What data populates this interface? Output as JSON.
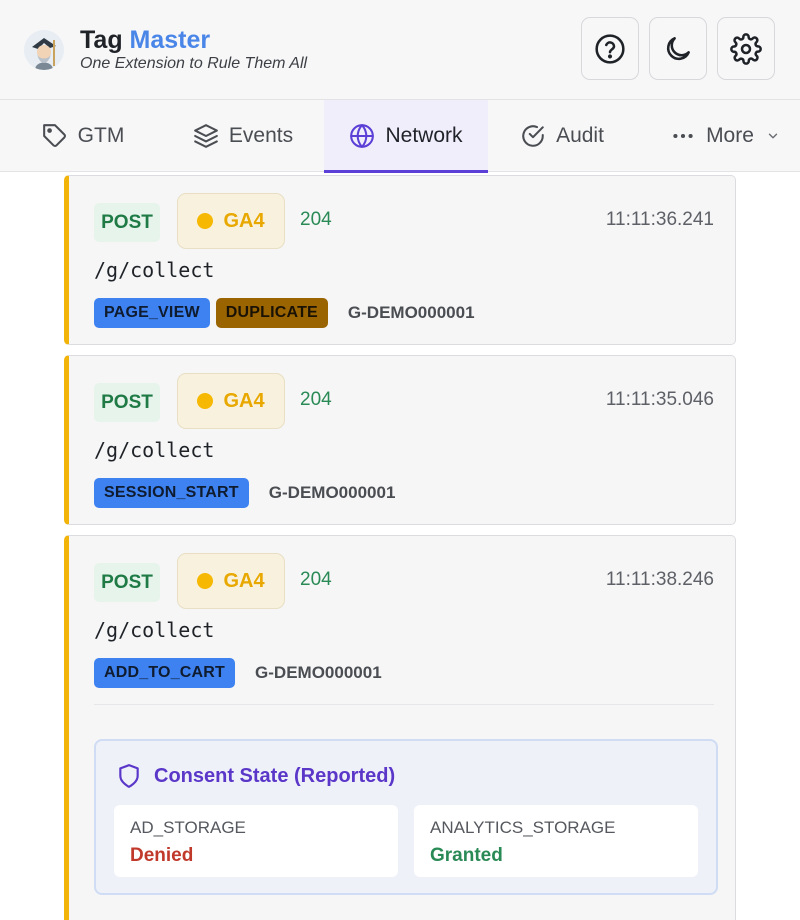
{
  "app": {
    "title_primary": "Tag",
    "title_accent": "Master",
    "subtitle": "One Extension to Rule Them All",
    "buttons": [
      {
        "icon": "help-circle-icon"
      },
      {
        "icon": "moon-icon"
      },
      {
        "icon": "gear-icon"
      }
    ]
  },
  "tabs": [
    {
      "label": "GTM",
      "icon": "tag-icon",
      "active": false
    },
    {
      "label": "Events",
      "icon": "layers-icon",
      "active": false
    },
    {
      "label": "Network",
      "icon": "globe-icon",
      "active": true
    },
    {
      "label": "Audit",
      "icon": "check-circle-icon",
      "active": false
    },
    {
      "label": "More",
      "icon": "ellipsis-icon",
      "active": false
    }
  ],
  "requests": [
    {
      "method": "POST",
      "vendor": "GA4",
      "status": "204",
      "time": "11:11:36.241",
      "path": "/g/collect",
      "event": "PAGE_VIEW",
      "flag": "DUPLICATE",
      "measurement_id": "G-DEMO000001"
    },
    {
      "method": "POST",
      "vendor": "GA4",
      "status": "204",
      "time": "11:11:35.046",
      "path": "/g/collect",
      "event": "SESSION_START",
      "measurement_id": "G-DEMO000001"
    },
    {
      "method": "POST",
      "vendor": "GA4",
      "status": "204",
      "time": "11:11:38.246",
      "path": "/g/collect",
      "event": "ADD_TO_CART",
      "measurement_id": "G-DEMO000001",
      "consent": {
        "title": "Consent State (Reported)",
        "items": [
          {
            "key": "AD_STORAGE",
            "value": "Denied"
          },
          {
            "key": "ANALYTICS_STORAGE",
            "value": "Granted"
          }
        ]
      }
    }
  ],
  "colors": {
    "accent": "#4a86e8",
    "tab_active": "#5b3fd6",
    "vendor_stripe": "#f3b40a",
    "event_badge": "#3d82f0",
    "duplicate_badge": "#9a6400",
    "granted": "#2a8a55",
    "denied": "#c0392b"
  }
}
